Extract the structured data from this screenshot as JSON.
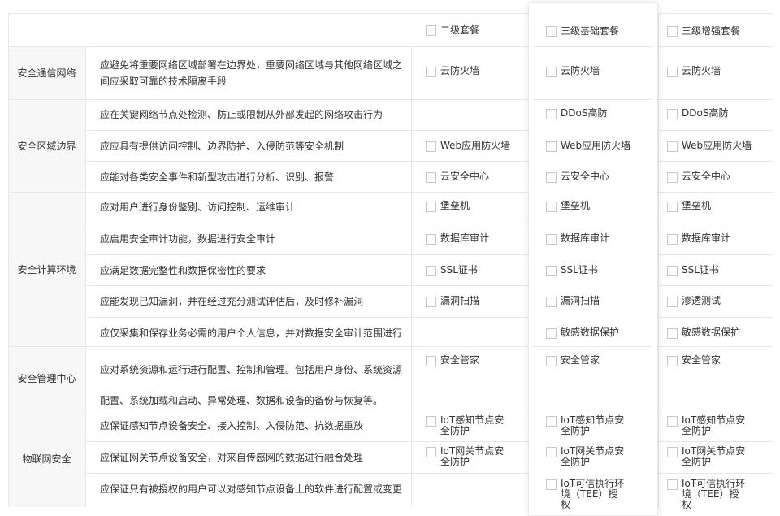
{
  "plans": [
    "二级套餐",
    "三级基础套餐",
    "三级增强套餐"
  ],
  "categories": [
    {
      "label": "安全通信网络"
    },
    {
      "label": "安全区域边界"
    },
    {
      "label": "安全计算环境"
    },
    {
      "label": "安全管理中心"
    },
    {
      "label": "物联网安全"
    }
  ],
  "requirements": [
    {
      "text": "应避免将重要网络区域部署在边界处，重要网络区域与其他网络区域之间应采取可靠的技术隔离手段",
      "cells": [
        "云防火墙",
        "云防火墙",
        "云防火墙"
      ]
    },
    {
      "text": "应在关键网络节点处检测、防止或限制从外部发起的网络攻击行为",
      "cells": [
        "",
        "DDoS高防",
        "DDoS高防"
      ]
    },
    {
      "text": "应应具有提供访问控制、边界防护、入侵防范等安全机制",
      "cells": [
        "Web应用防火墙",
        "Web应用防火墙",
        "Web应用防火墙"
      ]
    },
    {
      "text": "应能对各类安全事件和新型攻击进行分析、识别、报警",
      "cells": [
        "云安全中心",
        "云安全中心",
        "云安全中心"
      ]
    },
    {
      "text": "应对用户进行身份鉴别、访问控制、运维审计",
      "cells": [
        "堡垒机",
        "堡垒机",
        "堡垒机"
      ]
    },
    {
      "text": "应启用安全审计功能，数据进行安全审计",
      "cells": [
        "数据库审计",
        "数据库审计",
        "数据库审计"
      ]
    },
    {
      "text": "应满足数据完整性和数据保密性的要求",
      "cells": [
        "SSL证书",
        "SSL证书",
        "SSL证书"
      ]
    },
    {
      "text": "应能发现已知漏洞，并在经过充分测试评估后，及时修补漏洞",
      "cells": [
        "漏洞扫描",
        "漏洞扫描",
        "渗透测试"
      ]
    },
    {
      "text": "应仅采集和保存业务必需的用户个人信息，并对数据安全审计范围进行",
      "cells": [
        "",
        "敏感数据保护",
        "敏感数据保护"
      ]
    },
    {
      "text": "应对系统资源和运行进行配置、控制和管理。包括用户身份、系统资源配置、系统加载和启动、异常处理、数据和设备的备份与恢复等。",
      "cells": [
        "安全管家",
        "安全管家",
        "安全管家"
      ]
    },
    {
      "text": "应保证感知节点设备安全、接入控制、入侵防范、抗数据重放",
      "cells": [
        "IoT感知节点安全防护",
        "IoT感知节点安全防护",
        "IoT感知节点安全防护"
      ]
    },
    {
      "text": "应保证网关节点设备安全，对来自传感网的数据进行融合处理",
      "cells": [
        "IoT网关节点安全防护",
        "IoT网关节点安全防护",
        "IoT网关节点安全防护"
      ]
    },
    {
      "text": "应保证只有被授权的用户可以对感知节点设备上的软件进行配置或变更",
      "cells": [
        "",
        "IoT可信执行环境（TEE）授权",
        "IoT可信执行环境（TEE）授权"
      ]
    }
  ]
}
